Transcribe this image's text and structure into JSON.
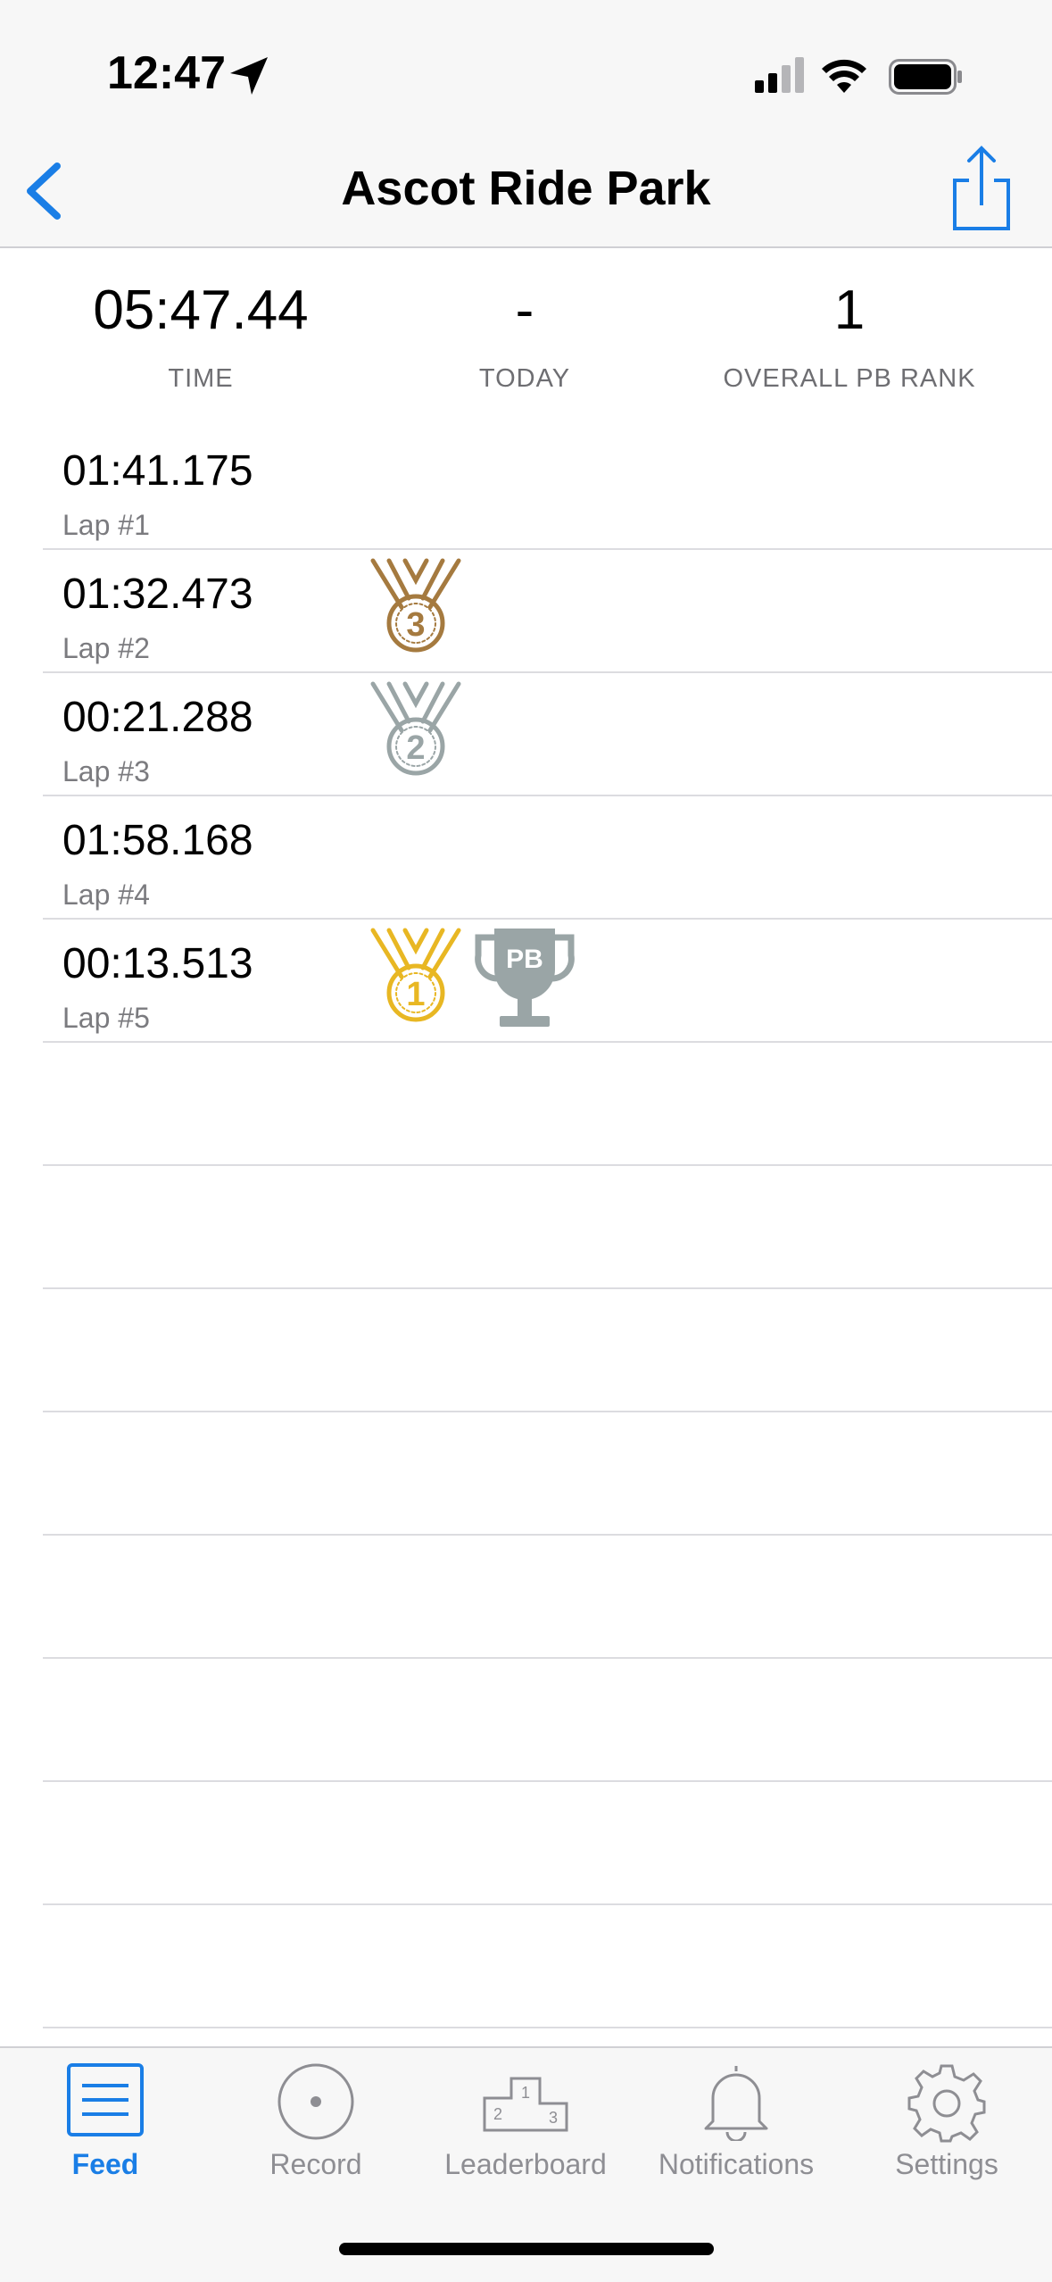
{
  "status_bar": {
    "time": "12:47"
  },
  "nav": {
    "title": "Ascot Ride Park"
  },
  "summary": {
    "time_value": "05:47.44",
    "time_label": "TIME",
    "today_value": "-",
    "today_label": "TODAY",
    "rank_value": "1",
    "rank_label": "OVERALL PB RANK"
  },
  "laps": [
    {
      "time": "01:41.175",
      "label": "Lap #1",
      "medal": null,
      "pb": false
    },
    {
      "time": "01:32.473",
      "label": "Lap #2",
      "medal": "3",
      "pb": false
    },
    {
      "time": "00:21.288",
      "label": "Lap #3",
      "medal": "2",
      "pb": false
    },
    {
      "time": "01:58.168",
      "label": "Lap #4",
      "medal": null,
      "pb": false
    },
    {
      "time": "00:13.513",
      "label": "Lap #5",
      "medal": "1",
      "pb": true
    }
  ],
  "trophy_text": "PB",
  "podium_numbers": [
    "1",
    "2",
    "3"
  ],
  "tabs": [
    {
      "label": "Feed",
      "icon": "feed-icon",
      "active": true
    },
    {
      "label": "Record",
      "icon": "record-icon",
      "active": false
    },
    {
      "label": "Leaderboard",
      "icon": "podium-icon",
      "active": false
    },
    {
      "label": "Notifications",
      "icon": "bell-icon",
      "active": false
    },
    {
      "label": "Settings",
      "icon": "gear-icon",
      "active": false
    }
  ],
  "colors": {
    "accent": "#1a7ee6",
    "gold": "#e8b723",
    "silver": "#9aa5a6",
    "bronze": "#a57a3f"
  }
}
